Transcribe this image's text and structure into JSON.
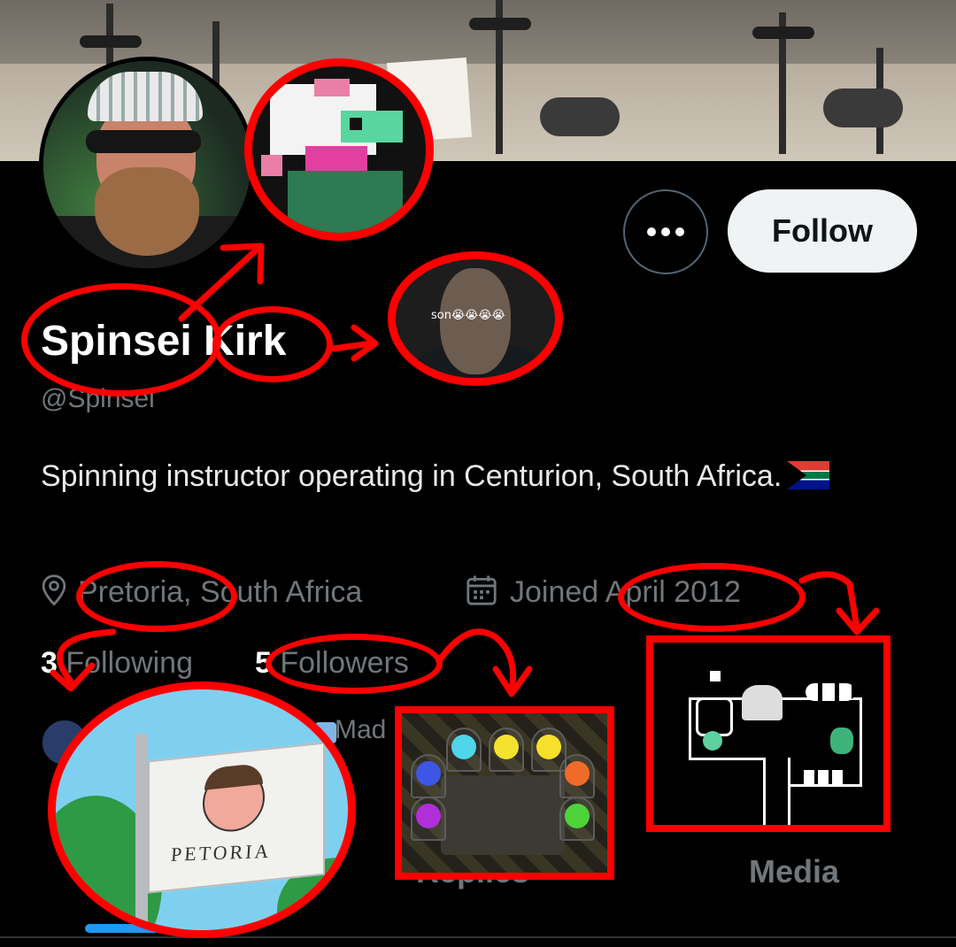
{
  "profile": {
    "name": "Spinsei Kirk",
    "handle": "@Spinsei",
    "bio": "Spinning instructor operating in Centurion, South Africa.",
    "location": "Pretoria, South Africa",
    "joined": "Joined April 2012",
    "following_count": "3",
    "following_label": "Following",
    "followers_count": "5",
    "followers_label": "Followers",
    "followed_by_partial": "Mad"
  },
  "actions": {
    "more_label": "More",
    "follow_label": "Follow"
  },
  "tabs": [
    {
      "label": "Replies"
    },
    {
      "label": "Media"
    }
  ],
  "annotations": {
    "meme_caption": "son😭😭😭😭",
    "flag_caption": "PETORIA",
    "color": "#ff0000"
  },
  "icons": [
    "location-pin-icon",
    "calendar-icon",
    "more-dots-icon",
    "south-africa-flag-icon"
  ],
  "colors": {
    "background": "#000000",
    "text_primary": "#e7e9ea",
    "text_secondary": "#71767b",
    "follow_button_bg": "#eff3f4",
    "tab_underline": "#1d9bf0",
    "annotation_red": "#ff0000"
  }
}
